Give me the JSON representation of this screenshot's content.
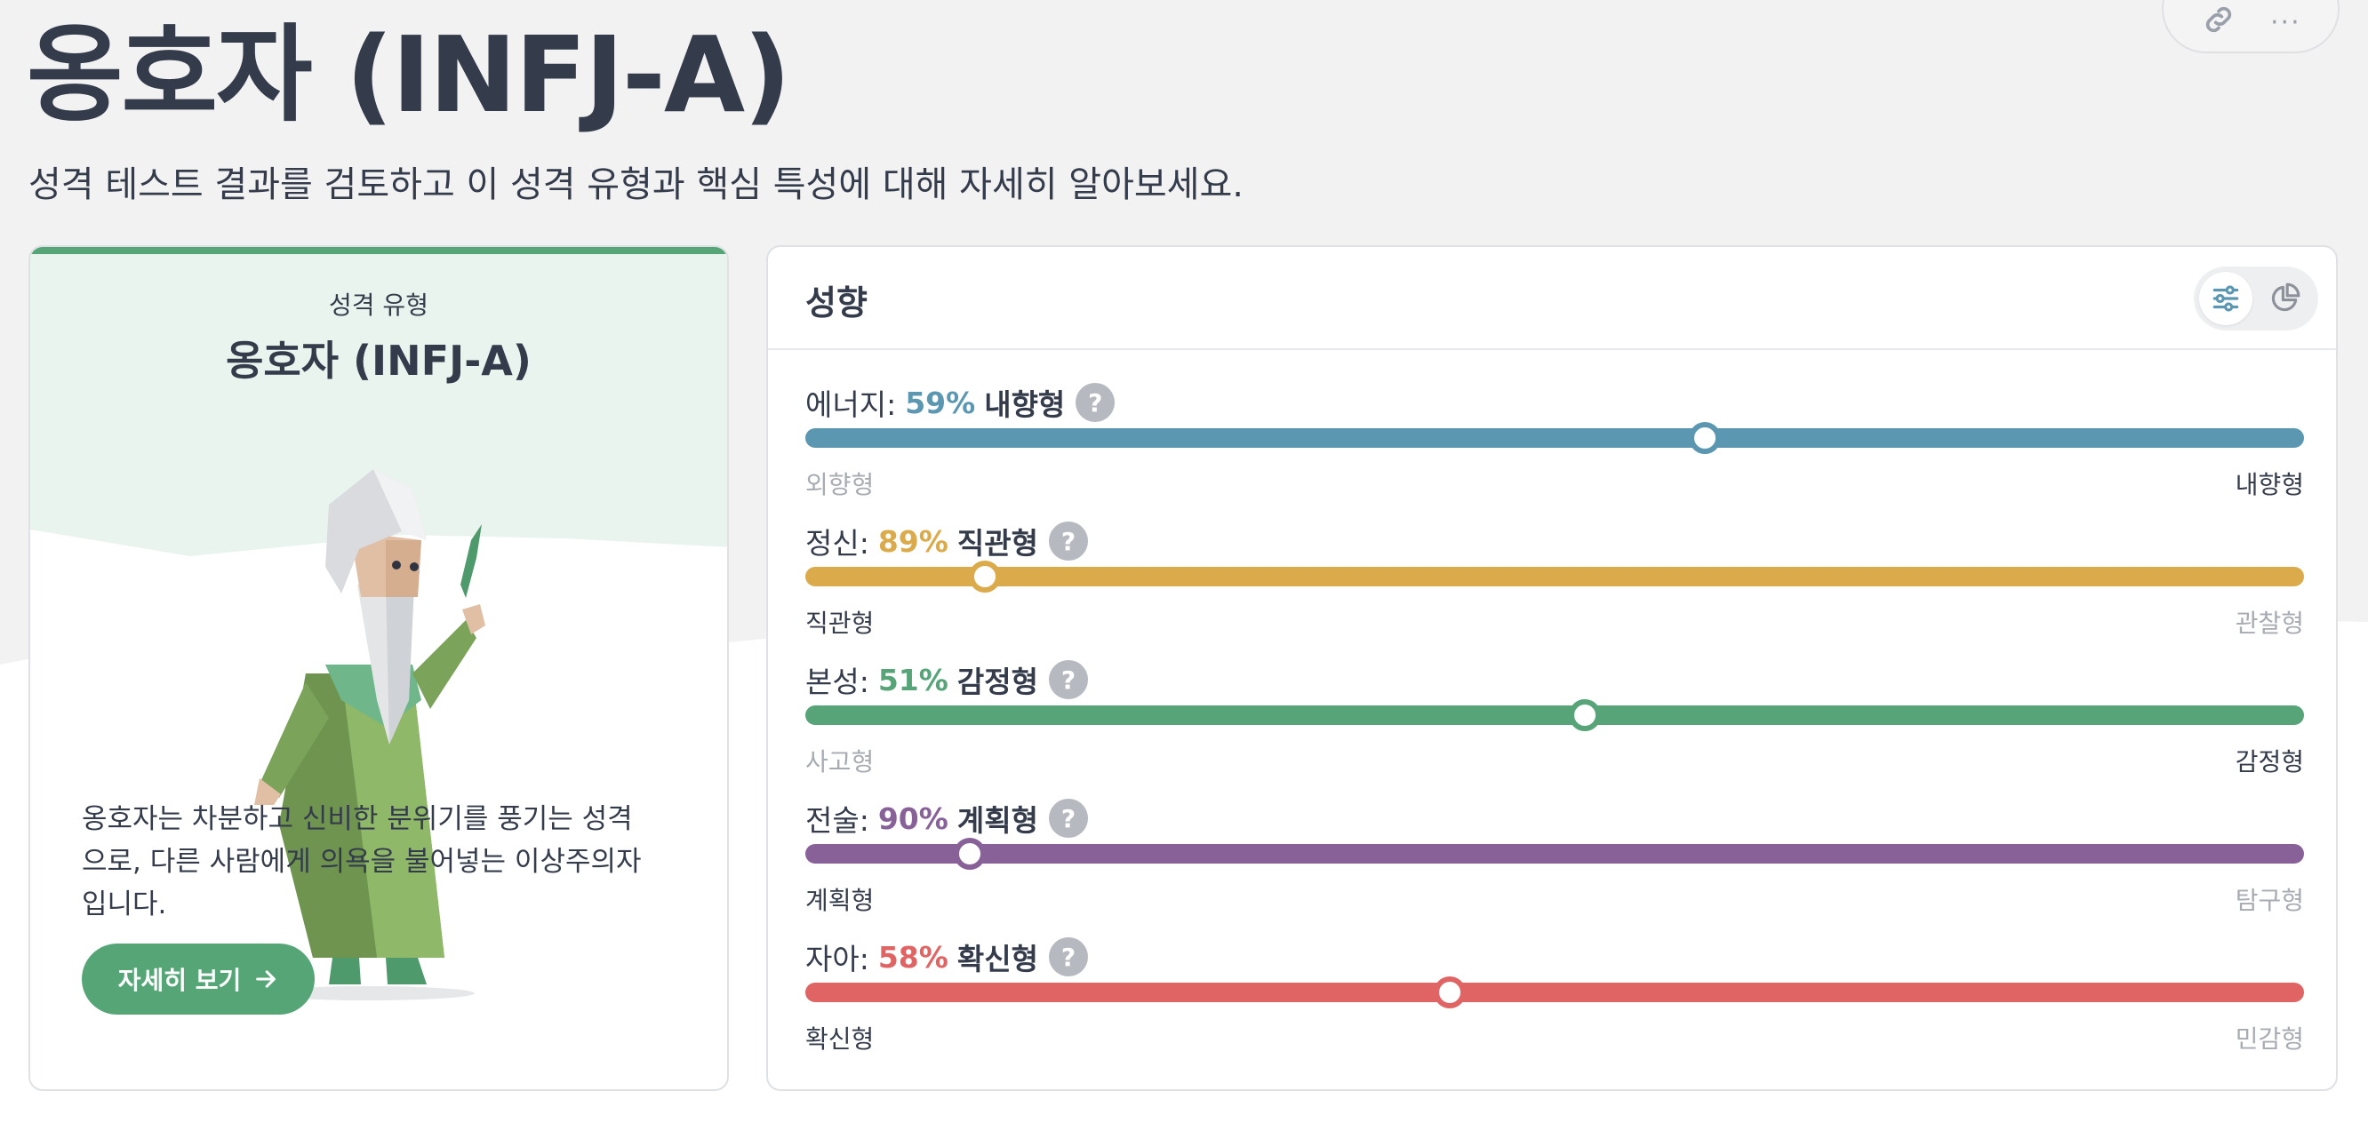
{
  "page": {
    "title": "옹호자 (INFJ-A)",
    "subtitle": "성격 테스트 결과를 검토하고 이 성격 유형과 핵심 특성에 대해 자세히 알아보세요."
  },
  "top_actions": {
    "icons": [
      "link-icon",
      "more-icon"
    ],
    "more_glyph": "···"
  },
  "type_card": {
    "eyebrow": "성격 유형",
    "type_name": "옹호자 (INFJ-A)",
    "description": "옹호자는 차분하고 신비한 분위기를 풍기는 성격으로, 다른 사람에게 의욕을 불어넣는 이상주의자입니다.",
    "button_label": "자세히 보기",
    "accent_color": "#55a577"
  },
  "traits_card": {
    "title": "성향",
    "view_toggle": [
      "sliders-icon",
      "pie-chart-icon"
    ],
    "traits": [
      {
        "category": "에너지:",
        "percent": "59%",
        "trait": "내향형",
        "color": "#5b97b1",
        "position": 0.6,
        "left_pole": "외향형",
        "right_pole": "내향형",
        "active_side": "right",
        "help": "?"
      },
      {
        "category": "정신:",
        "percent": "89%",
        "trait": "직관형",
        "color": "#dbab4b",
        "position": 0.12,
        "left_pole": "직관형",
        "right_pole": "관찰형",
        "active_side": "left",
        "help": "?"
      },
      {
        "category": "본성:",
        "percent": "51%",
        "trait": "감정형",
        "color": "#56a477",
        "position": 0.52,
        "left_pole": "사고형",
        "right_pole": "감정형",
        "active_side": "right",
        "help": "?"
      },
      {
        "category": "전술:",
        "percent": "90%",
        "trait": "계획형",
        "color": "#886198",
        "position": 0.11,
        "left_pole": "계획형",
        "right_pole": "탐구형",
        "active_side": "left",
        "help": "?"
      },
      {
        "category": "자아:",
        "percent": "58%",
        "trait": "확신형",
        "color": "#e06464",
        "position": 0.43,
        "left_pole": "확신형",
        "right_pole": "민감형",
        "active_side": "left",
        "help": "?"
      }
    ]
  }
}
